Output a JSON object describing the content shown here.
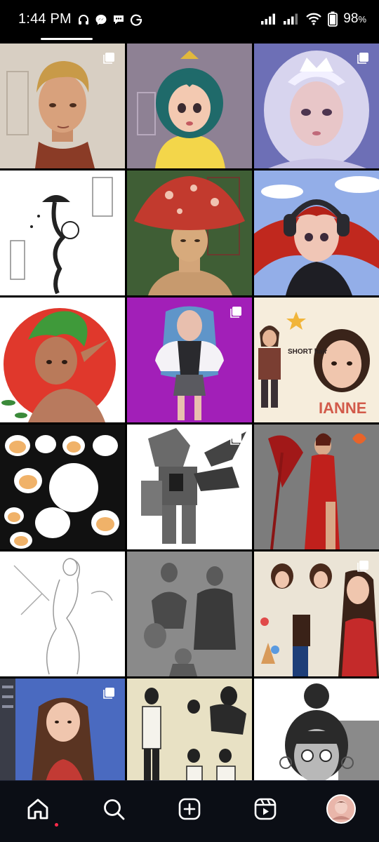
{
  "status_bar": {
    "time": "1:44 PM",
    "battery": "98",
    "battery_unit": "%",
    "left_icons": [
      "headphones-icon",
      "messenger-icon",
      "chat-bubble-icon",
      "g-icon"
    ],
    "right_icons": [
      "signal-icon",
      "signal-icon",
      "wifi-icon",
      "battery-icon"
    ]
  },
  "grid": {
    "posts": [
      {
        "subject": "man-portrait",
        "multi": true
      },
      {
        "subject": "teal-hair-girl",
        "multi": false
      },
      {
        "subject": "white-hair-crown",
        "multi": true
      },
      {
        "subject": "mushroom-tattoo",
        "multi": false
      },
      {
        "subject": "mushroom-person",
        "multi": false
      },
      {
        "subject": "headphones-girl",
        "multi": true
      },
      {
        "subject": "green-hair-elf",
        "multi": false
      },
      {
        "subject": "blue-hair-girl",
        "multi": true
      },
      {
        "subject": "short-hair-sheet",
        "multi": false
      },
      {
        "subject": "hamster-stickers",
        "multi": false
      },
      {
        "subject": "mech-armor",
        "multi": true
      },
      {
        "subject": "red-dress-scythe",
        "multi": false
      },
      {
        "subject": "pencil-sketch",
        "multi": false
      },
      {
        "subject": "grey-figure-studies",
        "multi": false
      },
      {
        "subject": "ice-cream-sheet",
        "multi": true
      },
      {
        "subject": "red-top-girl",
        "multi": true
      },
      {
        "subject": "line-figures",
        "multi": false
      },
      {
        "subject": "bw-bun-girl",
        "multi": false
      }
    ],
    "text_in_art": {
      "short_hair": "SHORT hair",
      "name_banner": "IANNE"
    }
  },
  "nav": {
    "items": [
      "home-icon",
      "search-icon",
      "create-icon",
      "reels-icon",
      "profile-avatar"
    ],
    "accent": "#ff2a4a"
  }
}
